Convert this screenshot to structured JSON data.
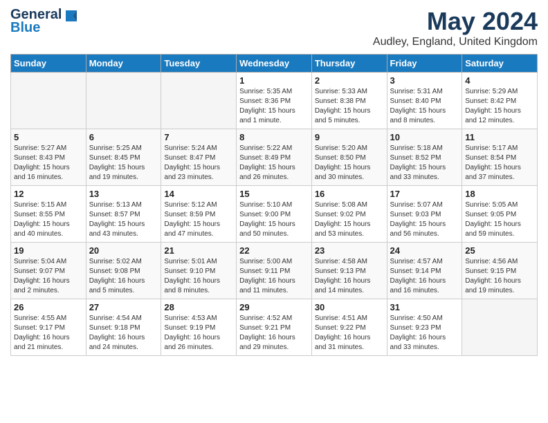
{
  "logo": {
    "general": "General",
    "blue": "Blue"
  },
  "title": "May 2024",
  "location": "Audley, England, United Kingdom",
  "days_header": [
    "Sunday",
    "Monday",
    "Tuesday",
    "Wednesday",
    "Thursday",
    "Friday",
    "Saturday"
  ],
  "weeks": [
    [
      {
        "num": "",
        "info": ""
      },
      {
        "num": "",
        "info": ""
      },
      {
        "num": "",
        "info": ""
      },
      {
        "num": "1",
        "info": "Sunrise: 5:35 AM\nSunset: 8:36 PM\nDaylight: 15 hours\nand 1 minute."
      },
      {
        "num": "2",
        "info": "Sunrise: 5:33 AM\nSunset: 8:38 PM\nDaylight: 15 hours\nand 5 minutes."
      },
      {
        "num": "3",
        "info": "Sunrise: 5:31 AM\nSunset: 8:40 PM\nDaylight: 15 hours\nand 8 minutes."
      },
      {
        "num": "4",
        "info": "Sunrise: 5:29 AM\nSunset: 8:42 PM\nDaylight: 15 hours\nand 12 minutes."
      }
    ],
    [
      {
        "num": "5",
        "info": "Sunrise: 5:27 AM\nSunset: 8:43 PM\nDaylight: 15 hours\nand 16 minutes."
      },
      {
        "num": "6",
        "info": "Sunrise: 5:25 AM\nSunset: 8:45 PM\nDaylight: 15 hours\nand 19 minutes."
      },
      {
        "num": "7",
        "info": "Sunrise: 5:24 AM\nSunset: 8:47 PM\nDaylight: 15 hours\nand 23 minutes."
      },
      {
        "num": "8",
        "info": "Sunrise: 5:22 AM\nSunset: 8:49 PM\nDaylight: 15 hours\nand 26 minutes."
      },
      {
        "num": "9",
        "info": "Sunrise: 5:20 AM\nSunset: 8:50 PM\nDaylight: 15 hours\nand 30 minutes."
      },
      {
        "num": "10",
        "info": "Sunrise: 5:18 AM\nSunset: 8:52 PM\nDaylight: 15 hours\nand 33 minutes."
      },
      {
        "num": "11",
        "info": "Sunrise: 5:17 AM\nSunset: 8:54 PM\nDaylight: 15 hours\nand 37 minutes."
      }
    ],
    [
      {
        "num": "12",
        "info": "Sunrise: 5:15 AM\nSunset: 8:55 PM\nDaylight: 15 hours\nand 40 minutes."
      },
      {
        "num": "13",
        "info": "Sunrise: 5:13 AM\nSunset: 8:57 PM\nDaylight: 15 hours\nand 43 minutes."
      },
      {
        "num": "14",
        "info": "Sunrise: 5:12 AM\nSunset: 8:59 PM\nDaylight: 15 hours\nand 47 minutes."
      },
      {
        "num": "15",
        "info": "Sunrise: 5:10 AM\nSunset: 9:00 PM\nDaylight: 15 hours\nand 50 minutes."
      },
      {
        "num": "16",
        "info": "Sunrise: 5:08 AM\nSunset: 9:02 PM\nDaylight: 15 hours\nand 53 minutes."
      },
      {
        "num": "17",
        "info": "Sunrise: 5:07 AM\nSunset: 9:03 PM\nDaylight: 15 hours\nand 56 minutes."
      },
      {
        "num": "18",
        "info": "Sunrise: 5:05 AM\nSunset: 9:05 PM\nDaylight: 15 hours\nand 59 minutes."
      }
    ],
    [
      {
        "num": "19",
        "info": "Sunrise: 5:04 AM\nSunset: 9:07 PM\nDaylight: 16 hours\nand 2 minutes."
      },
      {
        "num": "20",
        "info": "Sunrise: 5:02 AM\nSunset: 9:08 PM\nDaylight: 16 hours\nand 5 minutes."
      },
      {
        "num": "21",
        "info": "Sunrise: 5:01 AM\nSunset: 9:10 PM\nDaylight: 16 hours\nand 8 minutes."
      },
      {
        "num": "22",
        "info": "Sunrise: 5:00 AM\nSunset: 9:11 PM\nDaylight: 16 hours\nand 11 minutes."
      },
      {
        "num": "23",
        "info": "Sunrise: 4:58 AM\nSunset: 9:13 PM\nDaylight: 16 hours\nand 14 minutes."
      },
      {
        "num": "24",
        "info": "Sunrise: 4:57 AM\nSunset: 9:14 PM\nDaylight: 16 hours\nand 16 minutes."
      },
      {
        "num": "25",
        "info": "Sunrise: 4:56 AM\nSunset: 9:15 PM\nDaylight: 16 hours\nand 19 minutes."
      }
    ],
    [
      {
        "num": "26",
        "info": "Sunrise: 4:55 AM\nSunset: 9:17 PM\nDaylight: 16 hours\nand 21 minutes."
      },
      {
        "num": "27",
        "info": "Sunrise: 4:54 AM\nSunset: 9:18 PM\nDaylight: 16 hours\nand 24 minutes."
      },
      {
        "num": "28",
        "info": "Sunrise: 4:53 AM\nSunset: 9:19 PM\nDaylight: 16 hours\nand 26 minutes."
      },
      {
        "num": "29",
        "info": "Sunrise: 4:52 AM\nSunset: 9:21 PM\nDaylight: 16 hours\nand 29 minutes."
      },
      {
        "num": "30",
        "info": "Sunrise: 4:51 AM\nSunset: 9:22 PM\nDaylight: 16 hours\nand 31 minutes."
      },
      {
        "num": "31",
        "info": "Sunrise: 4:50 AM\nSunset: 9:23 PM\nDaylight: 16 hours\nand 33 minutes."
      },
      {
        "num": "",
        "info": ""
      }
    ]
  ]
}
